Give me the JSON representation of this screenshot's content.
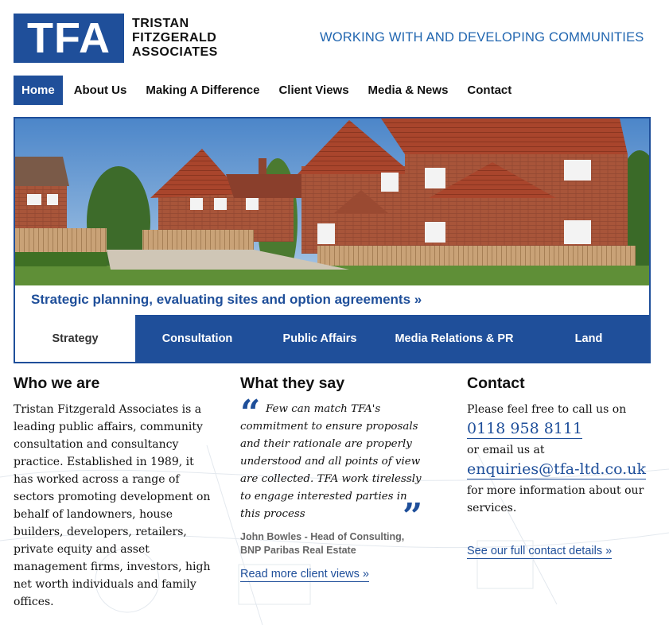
{
  "logo": {
    "mark": "TFA",
    "line1": "TRISTAN",
    "line2": "FITZGERALD",
    "line3": "ASSOCIATES"
  },
  "tagline": "WORKING WITH AND DEVELOPING COMMUNITIES",
  "nav": [
    {
      "label": "Home"
    },
    {
      "label": "About Us"
    },
    {
      "label": "Making A Difference"
    },
    {
      "label": "Client Views"
    },
    {
      "label": "Media & News"
    },
    {
      "label": "Contact"
    }
  ],
  "hero": {
    "caption": "Strategic planning, evaluating sites and option agreements »",
    "tabs": [
      {
        "label": "Strategy"
      },
      {
        "label": "Consultation"
      },
      {
        "label": "Public Affairs"
      },
      {
        "label": "Media Relations & PR"
      },
      {
        "label": "Land"
      }
    ]
  },
  "who": {
    "heading": "Who we are",
    "body": "Tristan Fitzgerald Associates is a leading public affairs, community consultation and consultancy practice. Established in 1989, it has worked across a range of sectors promoting development on behalf of landowners, house builders, developers, retailers, private equity and asset management firms, investors, high net worth individuals and family offices."
  },
  "say": {
    "heading": "What they say",
    "quote": "Few can match TFA's commitment to ensure proposals and their rationale are properly understood and all points of view are collected. TFA work tirelessly to engage interested parties in this process",
    "author_line1": "John Bowles - Head of Consulting,",
    "author_line2": "BNP Paribas Real Estate",
    "read_more": "Read more client views »"
  },
  "contact": {
    "heading": "Contact",
    "intro": "Please feel free to call us on",
    "phone": "0118 958 8111",
    "or_email": "or email us at",
    "email": "enquiries@tfa-ltd.co.uk",
    "more_info": "for more information about our services.",
    "details_link": "See our full contact details »"
  },
  "colors": {
    "brand_blue": "#1f4f9a",
    "tagline_blue": "#2166b0"
  }
}
